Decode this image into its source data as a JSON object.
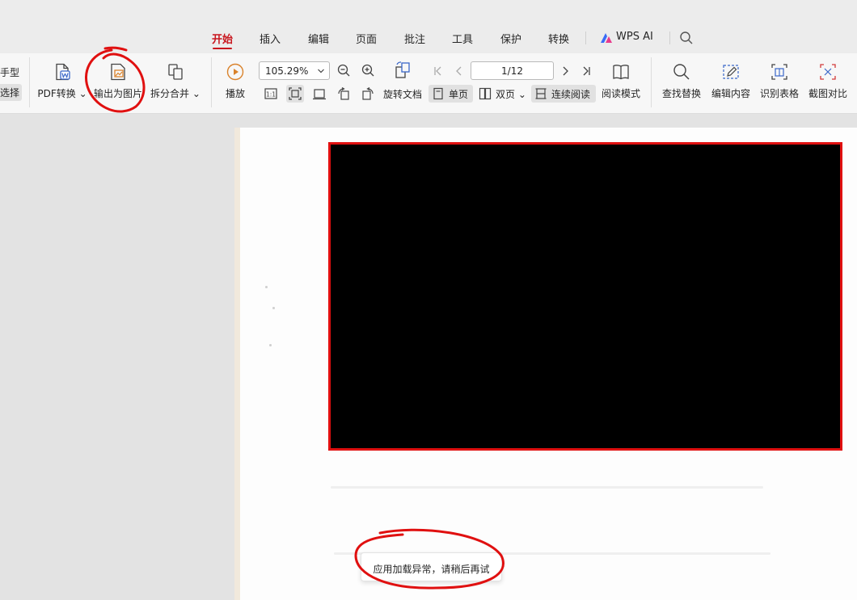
{
  "tabs": [
    {
      "label": "开始",
      "active": true
    },
    {
      "label": "插入"
    },
    {
      "label": "编辑"
    },
    {
      "label": "页面"
    },
    {
      "label": "批注"
    },
    {
      "label": "工具"
    },
    {
      "label": "保护"
    },
    {
      "label": "转换"
    },
    {
      "label": "WPS AI"
    }
  ],
  "ribbon": {
    "left_cut_top": "手型",
    "left_cut_bottom": "选择",
    "pdf_convert": "PDF转换",
    "export_image": "输出为图片",
    "split_merge": "拆分合并",
    "play": "播放",
    "zoom": "105.29%",
    "rotate_doc": "旋转文档",
    "single_page": "单页",
    "double_page": "双页",
    "continuous_read": "连续阅读",
    "page_indicator": "1/12",
    "reading_mode": "阅读模式",
    "find_replace": "查找替换",
    "edit_content": "编辑内容",
    "recognize_table": "识别表格",
    "screenshot_compare": "截图对比"
  },
  "toast": {
    "message": "应用加载异常，请稍后再试"
  },
  "colors": {
    "accent": "#c8161e",
    "annotation_red": "#e01010",
    "ribbon_bg": "#f7f7f7",
    "tabbar_bg": "#ececec",
    "workspace_bg": "#e3e3e3"
  }
}
